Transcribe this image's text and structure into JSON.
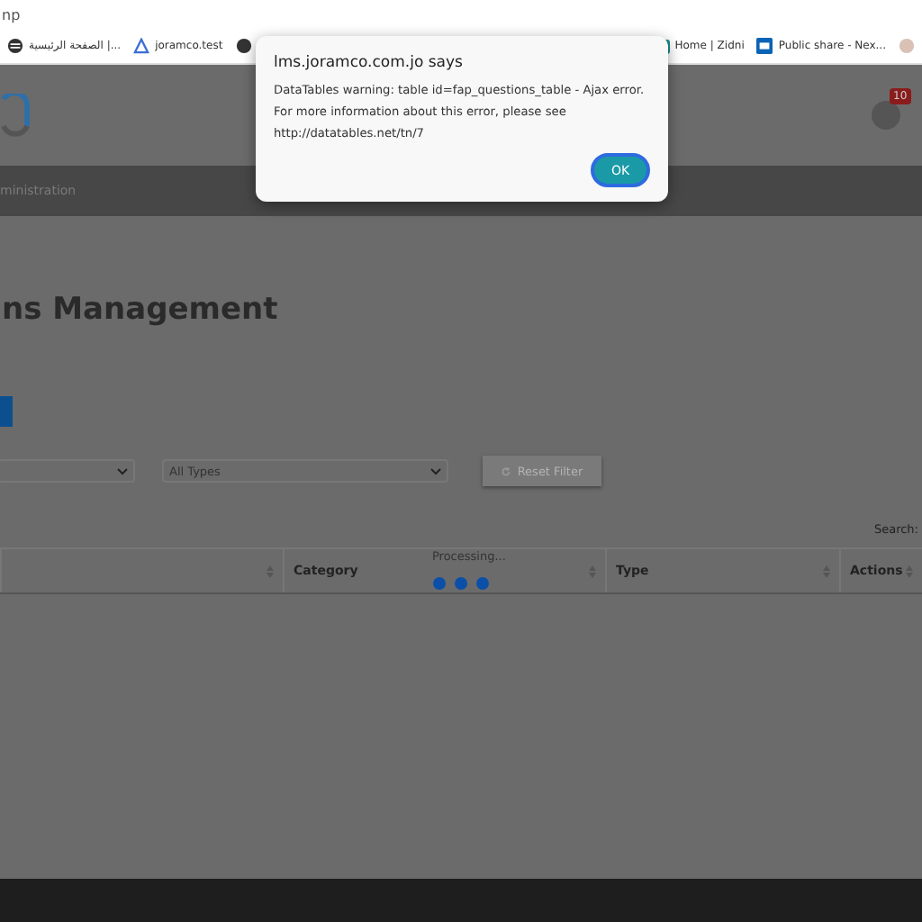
{
  "address_bar": {
    "text": "np"
  },
  "bookmarks_left": [
    {
      "label": "الصفحة الرئيسية |...",
      "kind": "globe"
    },
    {
      "label": "joramco.test",
      "kind": "triangle"
    },
    {
      "kind": "github"
    }
  ],
  "bookmarks_right": [
    {
      "label": "Home | Zidni",
      "kind": "square"
    },
    {
      "label": "Public share - Nex...",
      "kind": "folder"
    },
    {
      "kind": "round"
    }
  ],
  "header": {
    "badge": "10"
  },
  "nav": {
    "item": "ministration"
  },
  "page": {
    "title": "ns Management"
  },
  "filters": {
    "select_2": "All Types",
    "reset": "Reset Filter"
  },
  "search": {
    "label": "Search:"
  },
  "processing": {
    "text": "Processing..."
  },
  "table": {
    "columns": [
      "",
      "Category",
      "Type",
      "Actions"
    ]
  },
  "dialog": {
    "title": "lms.joramco.com.jo says",
    "message": "DataTables warning: table id=fap_questions_table - Ajax error. For more information about this error, please see http://datatables.net/tn/7",
    "button": "OK"
  }
}
